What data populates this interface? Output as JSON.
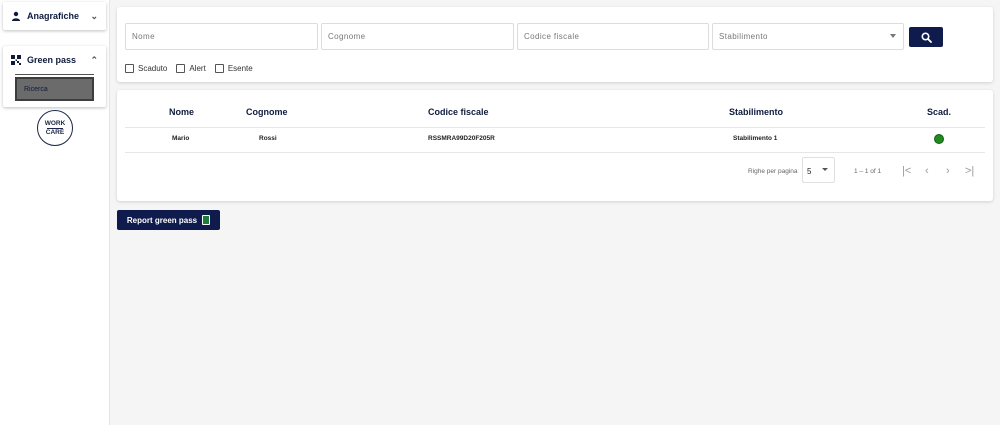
{
  "sidebar": {
    "anagrafiche_label": "Anagrafiche",
    "greenpass_label": "Green pass",
    "ricerca_label": "Ricerca",
    "logo_top": "WORK",
    "logo_bottom": "CARE"
  },
  "search": {
    "nome_placeholder": "Nome",
    "cognome_placeholder": "Cognome",
    "codice_placeholder": "Codice fiscale",
    "stabilimento_placeholder": "Stabilimento",
    "checks": [
      "Scaduto",
      "Alert",
      "Esente"
    ]
  },
  "table": {
    "headers": [
      "Nome",
      "Cognome",
      "Codice fiscale",
      "Stabilimento",
      "Scad."
    ],
    "rows": [
      [
        "Mario",
        "Rossi",
        "RSSMRA99D20F205R",
        "Stabilimento 1"
      ]
    ],
    "status_color": "#1f8a1f"
  },
  "pager": {
    "label": "Righe per pagina",
    "per_page": "5",
    "range": "1 – 1 of 1",
    "first": "|<",
    "prev": "‹",
    "next": "›",
    "last": ">|"
  },
  "report_label": "Report green pass",
  "colors": {
    "primary": "#0f1b4d",
    "status_ok": "#1f8a1f"
  }
}
